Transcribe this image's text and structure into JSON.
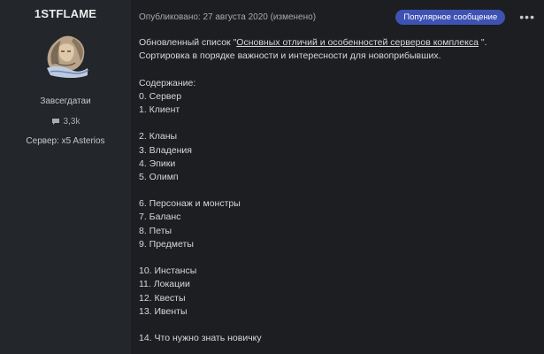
{
  "author": {
    "name": "1STFLAME",
    "title": "Завсегдатаи",
    "posts_count": "3,3k",
    "server": "Сервер: x5 Asterios"
  },
  "post": {
    "date": "Опубликовано: 27 августа 2020 (изменено)",
    "badge": "Популярное сообщение",
    "more": "•••",
    "intro_prefix": "Обновленный список  \"",
    "intro_link": "Основных отличий и особенностей серверов комплекса",
    "intro_suffix": " \".",
    "intro_line2": "Сортировка в порядке важности и интересности для новоприбывших.",
    "toc_heading": "Содержание:",
    "toc": [
      "0.  Сервер",
      "1.  Клиент",
      "",
      "2.  Кланы",
      "3.  Владения",
      "4.  Эпики",
      "5.  Олимп",
      "",
      "6.  Персонаж и монстры",
      "7.  Баланс",
      "8.  Петы",
      "9.  Предметы",
      "",
      "10. Инстансы",
      "11. Локации",
      "12. Квесты",
      "13. Ивенты",
      "",
      "14. Что нужно знать новичку"
    ]
  },
  "colors": {
    "badge": "#3e52b3",
    "sidebar": "#23262b",
    "background": "#1c1e22"
  },
  "icons": {
    "posts": "speech-bubble-icon",
    "more": "ellipsis-icon"
  }
}
